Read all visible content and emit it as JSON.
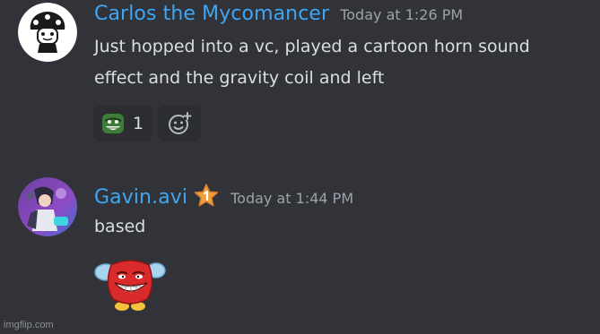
{
  "messages": [
    {
      "username": "Carlos the Mycomancer",
      "timestamp": "Today at 1:26 PM",
      "avatar_icon": "mushroom-character-avatar",
      "text": "Just hopped into a vc, played a cartoon horn sound effect and the gravity coil and left",
      "reactions": [
        {
          "emoji_icon": "green-troll-face-emoji",
          "count": "1"
        }
      ],
      "add_reaction_icon": "add-reaction-smiley-icon",
      "name_color": "#3ea6f3"
    },
    {
      "username": "Gavin.avi",
      "timestamp": "Today at 1:44 PM",
      "avatar_icon": "anime-character-avatar",
      "badge_icon": "orange-star-badge-icon",
      "text": "based",
      "sticker_icon": "red-troll-face-winged-sticker",
      "name_color": "#3ea6f3"
    }
  ],
  "watermark": "imgflip.com",
  "colors": {
    "background": "#313338",
    "username": "#3ea6f3",
    "timestamp": "#9ea2a8",
    "text": "#dbdee1",
    "reaction_bg": "#2b2d31"
  }
}
